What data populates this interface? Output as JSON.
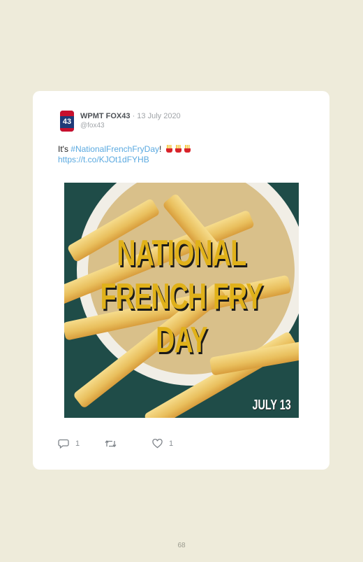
{
  "tweet": {
    "author_name": "WPMT FOX43",
    "separator": " · ",
    "date": "13 July 2020",
    "handle": "@fox43",
    "avatar_text": "43",
    "text_prefix": "It's ",
    "hashtag": "#NationalFrenchFryDay",
    "text_suffix": "!",
    "emojis": [
      "french-fries-emoji",
      "french-fries-emoji",
      "french-fries-emoji"
    ],
    "link": "https://t.co/KJOt1dFYHB"
  },
  "image": {
    "title_lines": [
      "NATIONAL",
      "FRENCH FRY",
      "DAY"
    ],
    "date_text": "JULY 13"
  },
  "actions": {
    "reply_count": "1",
    "retweet_count": "",
    "like_count": "1"
  },
  "footer": {
    "page_number": "68"
  },
  "colors": {
    "background": "#eeebda",
    "card": "#ffffff",
    "link": "#5aa9e0",
    "title_yellow": "#e0b11a"
  }
}
